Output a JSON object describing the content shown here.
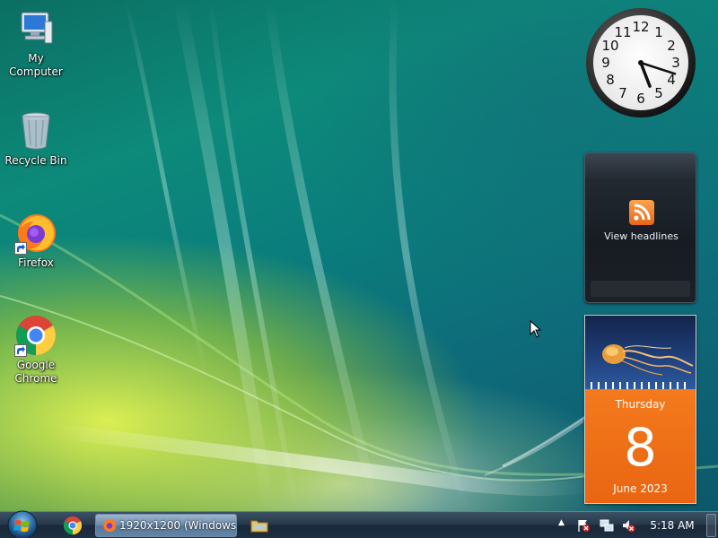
{
  "desktop": {
    "icons": [
      {
        "label": "My Computer",
        "icon": "computer-icon"
      },
      {
        "label": "Recycle Bin",
        "icon": "recycle-bin-icon"
      },
      {
        "label": "Firefox",
        "icon": "firefox-icon"
      },
      {
        "label": "Google Chrome",
        "icon": "chrome-icon"
      }
    ]
  },
  "gadgets": {
    "clock": {
      "icon": "analog-clock-icon",
      "hour": 5,
      "minute": 18
    },
    "feed": {
      "label": "View headlines",
      "icon": "rss-icon"
    },
    "calendar": {
      "weekday": "Thursday",
      "day": "8",
      "month_year": "June 2023"
    }
  },
  "taskbar": {
    "start_icon": "windows-start-icon",
    "quick_launch": [
      "chrome-icon"
    ],
    "active_task": {
      "label": "1920x1200 (Windows...",
      "icon": "firefox-icon"
    },
    "pinned": [
      "folder-icon"
    ],
    "tray_icons": [
      "show-hidden-icons",
      "action-center-flag-icon",
      "network-icon",
      "volume-muted-icon"
    ],
    "time": "5:18 AM"
  },
  "colors": {
    "taskbar": "#1d2f42",
    "calendar_orange": "#f47a1c",
    "feed_bg": "#1b2027"
  }
}
